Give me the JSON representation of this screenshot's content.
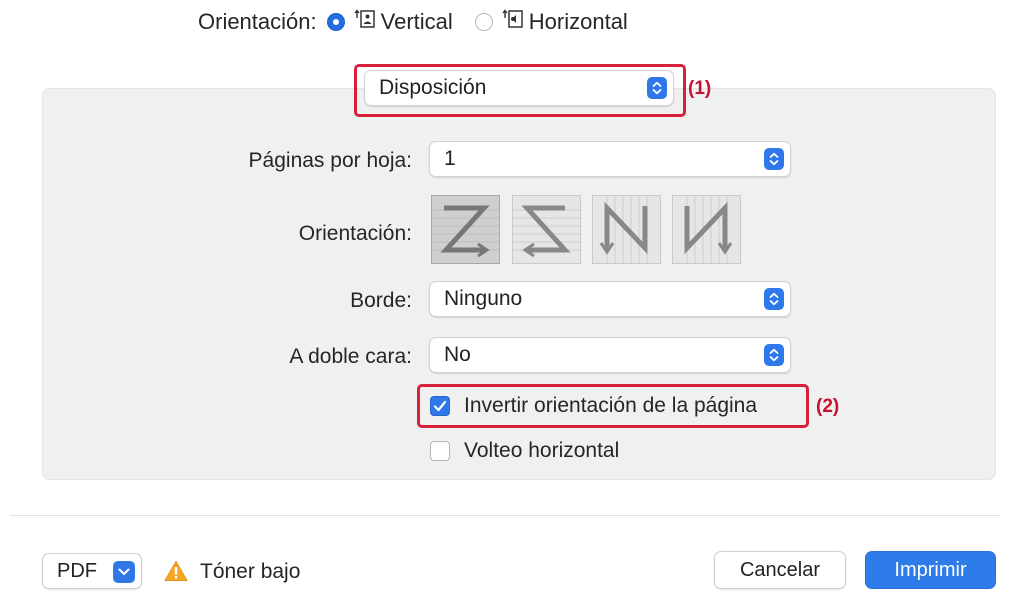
{
  "orientation_row": {
    "label": "Orientación:",
    "options": [
      {
        "label": "Vertical",
        "selected": true,
        "icon": "portrait-orientation-icon"
      },
      {
        "label": "Horizontal",
        "selected": false,
        "icon": "landscape-orientation-icon"
      }
    ]
  },
  "section_popup": {
    "value": "Disposición",
    "callout": "(1)"
  },
  "pages_per_sheet": {
    "label": "Páginas por hoja:",
    "value": "1"
  },
  "layout_direction": {
    "label": "Orientación:",
    "tiles": [
      "z-layout-icon",
      "reverse-z-layout-icon",
      "reverse-n-layout-icon",
      "n-layout-icon"
    ]
  },
  "border": {
    "label": "Borde:",
    "value": "Ninguno"
  },
  "two_sided": {
    "label": "A doble cara:",
    "value": "No"
  },
  "reverse_orientation": {
    "label": "Invertir orientación de la página",
    "checked": true,
    "callout": "(2)"
  },
  "flip_horizontal": {
    "label": "Volteo horizontal",
    "checked": false
  },
  "footer": {
    "pdf_label": "PDF",
    "warning_text": "Tóner bajo",
    "cancel_label": "Cancelar",
    "print_label": "Imprimir"
  },
  "colors": {
    "accent": "#2f78ea",
    "highlight": "#d8203a",
    "warning": "#f5a623"
  }
}
